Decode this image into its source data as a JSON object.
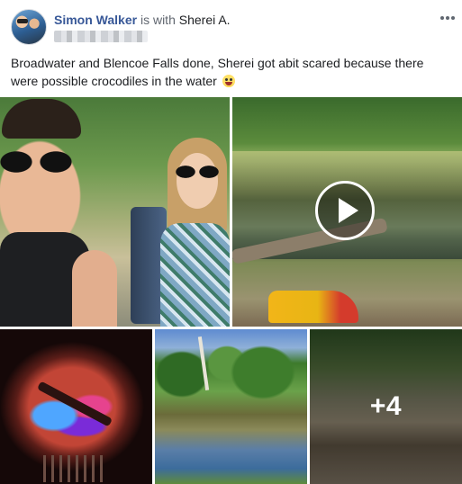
{
  "post": {
    "author": "Simon Walker",
    "with_text": " is with ",
    "tagged_user": "Sherei A.",
    "text": "Broadwater and Blencoe Falls done, Sherei got abit scared because there were possible crocodiles in the water",
    "emoji_icon": "laughing-tongue-emoji-icon",
    "more_icon": "ellipsis-icon",
    "play_icon": "play-icon",
    "extra_photos_label": "+4"
  },
  "colors": {
    "author_link": "#385898",
    "secondary_text": "#616770",
    "primary_text": "#1c1e21"
  }
}
